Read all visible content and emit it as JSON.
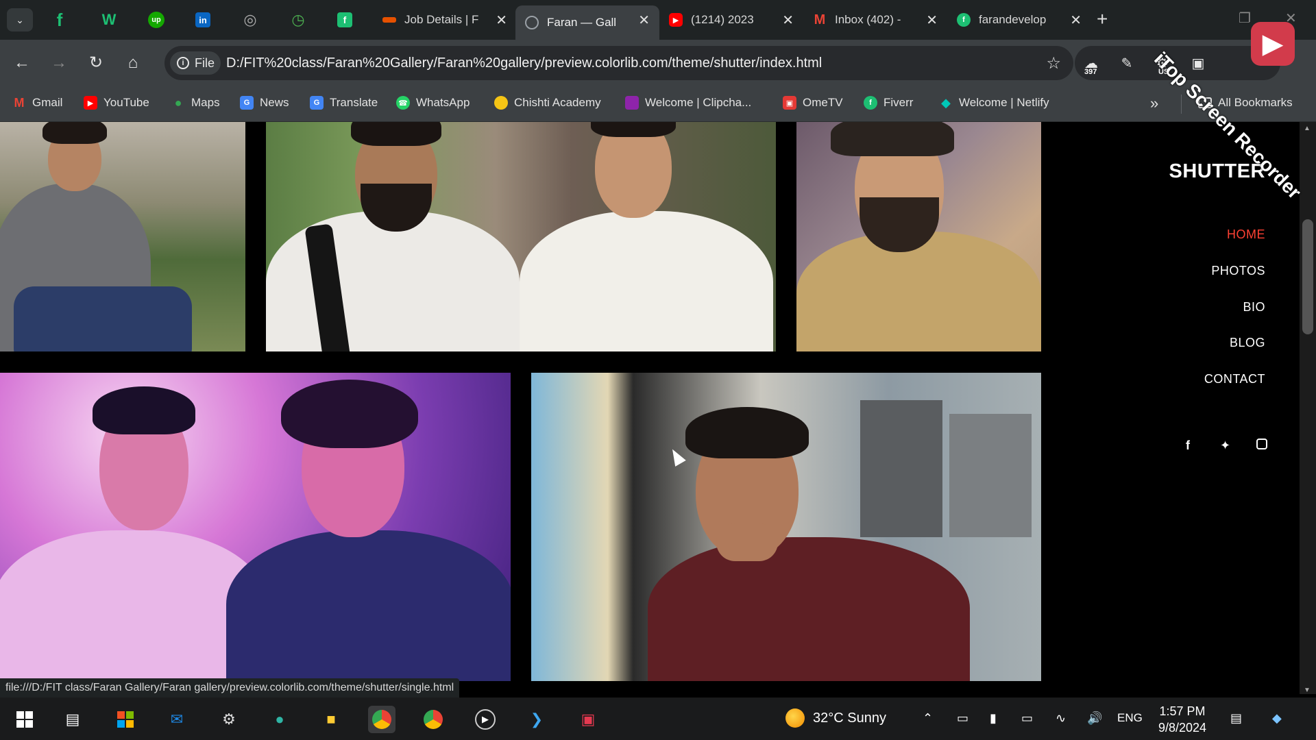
{
  "browser": {
    "pinned_tabs": [
      {
        "name": "fiverr",
        "glyph": "f",
        "color": "#1dbf73"
      },
      {
        "name": "wix",
        "glyph": "W",
        "color": "#1dbf73"
      },
      {
        "name": "upwork",
        "glyph": "up",
        "color": "#14a800"
      },
      {
        "name": "linkedin",
        "glyph": "in",
        "color": "#0a66c2"
      },
      {
        "name": "globe",
        "glyph": "◎",
        "color": "#888888"
      },
      {
        "name": "timer",
        "glyph": "◷",
        "color": "#4caf50"
      },
      {
        "name": "fiverr-square",
        "glyph": "f",
        "color": "#1dbf73"
      }
    ],
    "tabs": [
      {
        "title": "Job Details | F",
        "color": "#e65100"
      },
      {
        "title": "Faran — Gall",
        "color": "#9aa0a6",
        "active": true
      },
      {
        "title": "(1214) 2023",
        "color": "#ff0000"
      },
      {
        "title": "Inbox (402) -",
        "color": "#ea4335"
      },
      {
        "title": "farandevelop",
        "color": "#1dbf73"
      }
    ],
    "url_chip": "File",
    "url": "D:/FIT%20class/Faran%20Gallery/Faran%20gallery/preview.colorlib.com/theme/shutter/index.html",
    "ext_badges": {
      "count": "397",
      "lang": "US"
    },
    "bookmarks": [
      {
        "label": "Gmail",
        "color": "#ea4335",
        "glyph": "M"
      },
      {
        "label": "YouTube",
        "color": "#ff0000",
        "glyph": "▶"
      },
      {
        "label": "Maps",
        "color": "#34a853",
        "glyph": "●"
      },
      {
        "label": "News",
        "color": "#4285f4",
        "glyph": "G"
      },
      {
        "label": "Translate",
        "color": "#4285f4",
        "glyph": "G"
      },
      {
        "label": "WhatsApp",
        "color": "#25d366",
        "glyph": "◉"
      },
      {
        "label": "Chishti Academy",
        "color": "#f6c515",
        "glyph": "◎"
      },
      {
        "label": "Welcome | Clipcha...",
        "color": "#8e24aa",
        "glyph": "■"
      },
      {
        "label": "OmeTV",
        "color": "#e53935",
        "glyph": "▣"
      },
      {
        "label": "Fiverr",
        "color": "#1dbf73",
        "glyph": "f"
      },
      {
        "label": "Welcome | Netlify",
        "color": "#00c7b7",
        "glyph": "◆"
      }
    ],
    "all_bookmarks": "All Bookmarks",
    "status_url": "file:///D:/FIT class/Faran Gallery/Faran gallery/preview.colorlib.com/theme/shutter/single.html"
  },
  "site": {
    "brand": "SHUTTER",
    "menu": [
      "HOME",
      "PHOTOS",
      "BIO",
      "BLOG",
      "CONTACT"
    ],
    "active_menu": "HOME",
    "accent": "#ff4133",
    "social": [
      "f",
      "t",
      "ig"
    ]
  },
  "watermark": "iTop Screen Recorder",
  "taskbar": {
    "weather": "32°C  Sunny",
    "lang": "ENG",
    "time": "1:57 PM",
    "date": "9/8/2024"
  }
}
